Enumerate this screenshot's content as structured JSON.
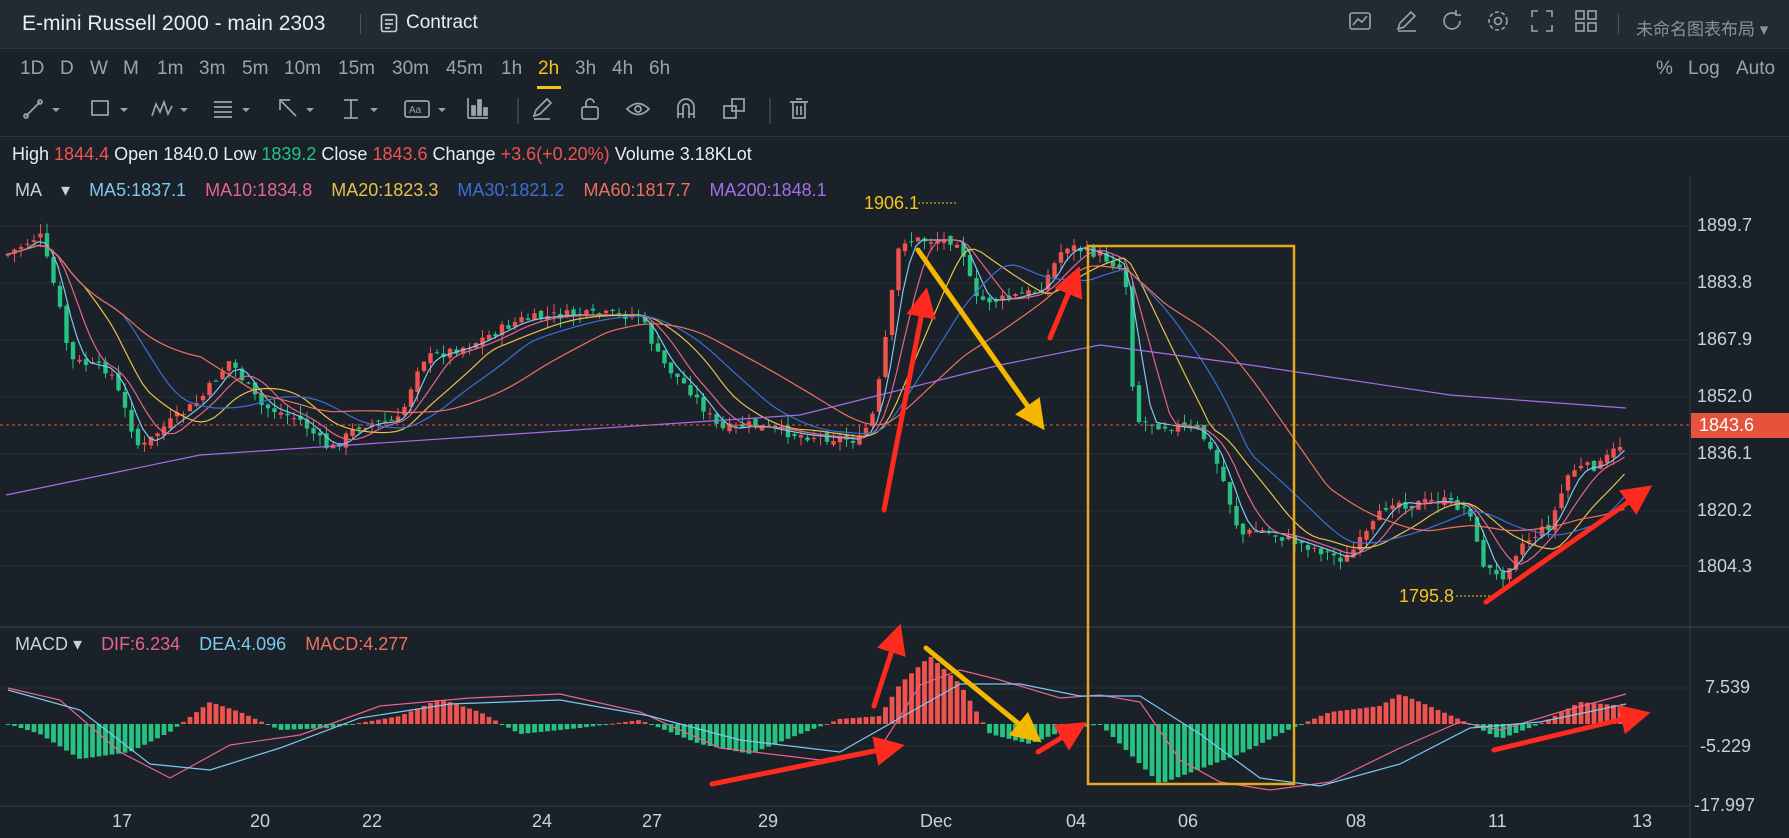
{
  "header": {
    "symbol_title": "E-mini Russell 2000 - main 2303",
    "contract_label": "Contract",
    "layout_name": "未命名图表布局"
  },
  "timeframes": [
    "1D",
    "D",
    "W",
    "M",
    "1m",
    "3m",
    "5m",
    "10m",
    "15m",
    "30m",
    "45m",
    "1h",
    "2h",
    "3h",
    "4h",
    "6h"
  ],
  "active_timeframe": "2h",
  "scale_options": [
    "%",
    "Log",
    "Auto"
  ],
  "toolbar_icons": [
    "trend-line-icon",
    "rectangle-icon",
    "pattern-icon",
    "fib-icon",
    "arrow-icon",
    "measure-icon",
    "text-icon",
    "indicator-icon",
    "pencil-icon",
    "lock-icon",
    "eye-icon",
    "magnet-icon",
    "clone-icon",
    "trash-icon"
  ],
  "header_icons": [
    "chart-type-icon",
    "edit-icon",
    "refresh-icon",
    "settings-icon",
    "fullscreen-icon",
    "layout-grid-icon"
  ],
  "ohlc": {
    "high_label": "High",
    "high": "1844.4",
    "open_label": "Open",
    "open": "1840.0",
    "low_label": "Low",
    "low": "1839.2",
    "close_label": "Close",
    "close": "1843.6",
    "change_label": "Change",
    "change": "+3.6(+0.20%)",
    "volume_label": "Volume",
    "volume": "3.18KLot"
  },
  "ma_legend": {
    "label": "MA",
    "items": [
      {
        "text": "MA5:1837.1",
        "color": "#7ec8f0"
      },
      {
        "text": "MA10:1834.8",
        "color": "#e8648c"
      },
      {
        "text": "MA20:1823.3",
        "color": "#e8c14a"
      },
      {
        "text": "MA30:1821.2",
        "color": "#3b6fd6"
      },
      {
        "text": "MA60:1817.7",
        "color": "#f07060"
      },
      {
        "text": "MA200:1848.1",
        "color": "#a56ee8"
      }
    ]
  },
  "macd_legend": {
    "label": "MACD",
    "items": [
      {
        "text": "DIF:6.234",
        "color": "#e8648c"
      },
      {
        "text": "DEA:4.096",
        "color": "#7ec8f0"
      },
      {
        "text": "MACD:4.277",
        "color": "#f07060"
      }
    ]
  },
  "price_axis": [
    "1899.7",
    "1883.8",
    "1867.9",
    "1852.0",
    "1836.1",
    "1820.2",
    "1804.3"
  ],
  "last_price": "1843.6",
  "macd_axis": [
    "7.539",
    "-5.229",
    "-17.997"
  ],
  "date_axis": [
    "17",
    "20",
    "22",
    "24",
    "27",
    "29",
    "Dec",
    "04",
    "06",
    "08",
    "11",
    "13"
  ],
  "annotations": {
    "high_marker": "1906.1",
    "low_marker": "1795.8"
  },
  "colors": {
    "up": "#ef5350",
    "down": "#26c281",
    "accent": "#f5c518",
    "background": "#1b2129",
    "price_tag": "#e5533d"
  }
}
